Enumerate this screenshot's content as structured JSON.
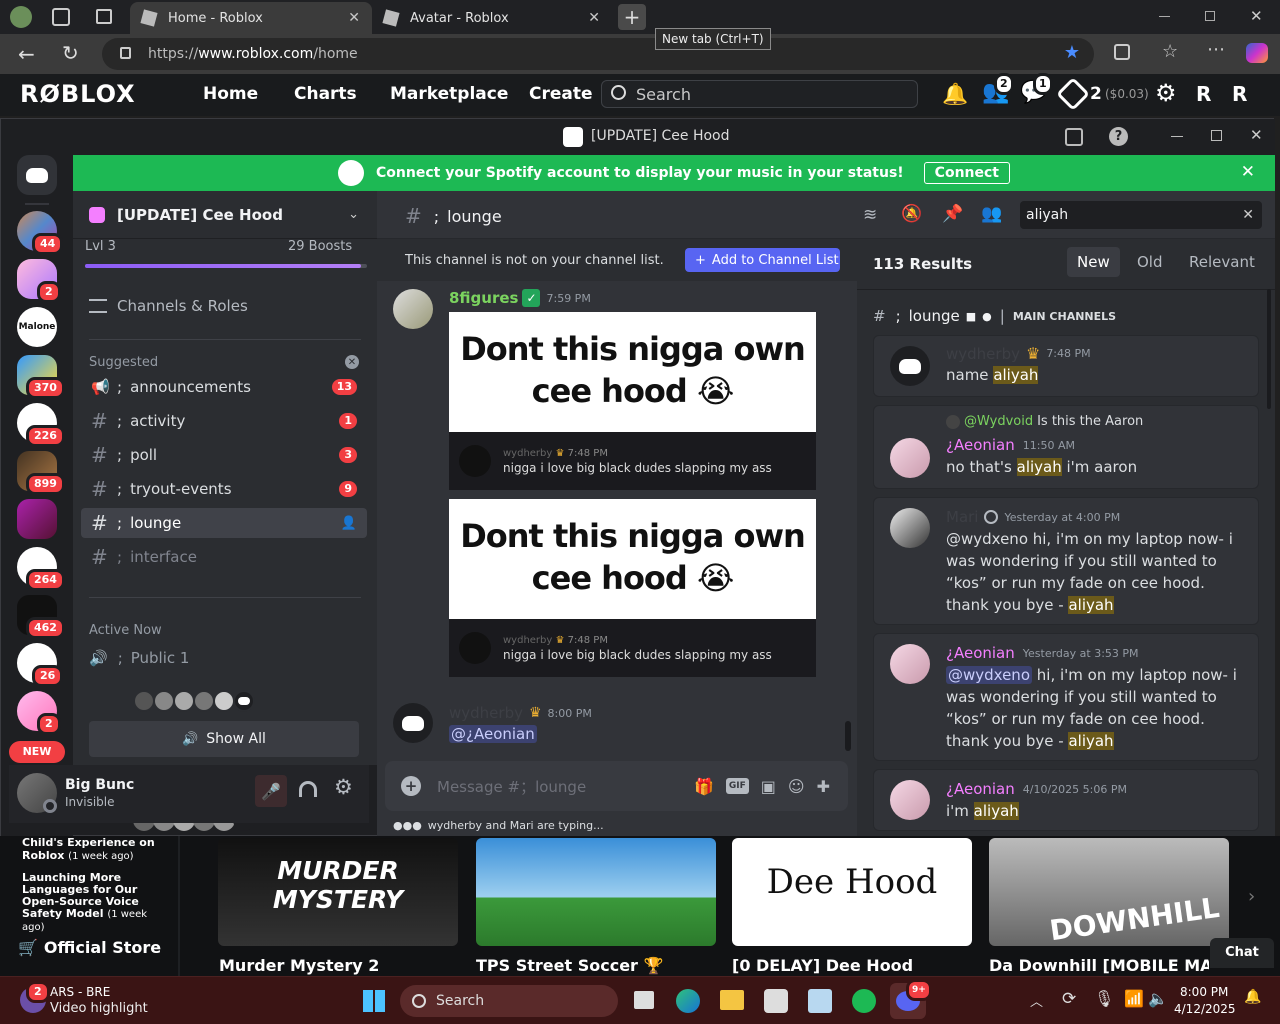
{
  "browser": {
    "tabs": [
      {
        "label": "Home - Roblox"
      },
      {
        "label": "Avatar - Roblox"
      }
    ],
    "new_tab_tooltip": "New tab (Ctrl+T)",
    "url_prefix": "https://",
    "url_host": "www.roblox.com",
    "url_path": "/home"
  },
  "roblox": {
    "logo": "RØBLOX",
    "nav": [
      "Home",
      "Charts",
      "Marketplace",
      "Create"
    ],
    "search_placeholder": "Search",
    "friends_badge": "2",
    "messages_badge": "1",
    "robux": "2",
    "robux_usd": "($0.03)",
    "news": [
      {
        "title": "Child's Experience on Roblox",
        "age": "(1 week ago)"
      },
      {
        "title": "Launching More Languages for Our Open-Source Voice Safety Model",
        "age": "(1 week ago)"
      }
    ],
    "official_store": "Official Store",
    "games": [
      {
        "title": "Murder Mystery 2",
        "thumb": "MURDER MYSTERY"
      },
      {
        "title": "TPS Street Soccer 🏆",
        "thumb": ""
      },
      {
        "title": "[0 DELAY] Dee Hood",
        "thumb": "Dee Hood"
      },
      {
        "title": "Da Downhill [MOBILE MACRO]",
        "thumb": "DOWNHILL"
      }
    ],
    "chat_label": "Chat"
  },
  "discord": {
    "window_title": "[UPDATE] Cee Hood",
    "spotify": {
      "text": "Connect your Spotify account to display your music in your status!",
      "button": "Connect"
    },
    "server_badges": [
      "44",
      "2",
      "",
      "370",
      "226",
      "899",
      "",
      "264",
      "462",
      "26",
      "2"
    ],
    "new_label": "NEW",
    "server": {
      "name": "[UPDATE] Cee Hood",
      "level": "Lvl 3",
      "boosts": "29 Boosts",
      "boost_progress": 0.98
    },
    "channels_roles": "Channels & Roles",
    "suggested_label": "Suggested",
    "channels": [
      {
        "name": "announcements",
        "count": "13",
        "icon": "megaphone-icon"
      },
      {
        "name": "activity",
        "count": "1",
        "icon": "hash-icon"
      },
      {
        "name": "poll",
        "count": "3",
        "icon": "hash-icon"
      },
      {
        "name": "tryout-events",
        "count": "9",
        "icon": "hash-icon"
      },
      {
        "name": "lounge",
        "count": "",
        "icon": "hash-icon"
      },
      {
        "name": "interface",
        "count": "",
        "icon": "hash-icon"
      }
    ],
    "channel_prefix": ";",
    "active_now": "Active Now",
    "voice_channel": "Public 1",
    "show_all": "Show All",
    "user": {
      "name": "Big Bunc",
      "status": "Invisible"
    },
    "chat": {
      "channel": "lounge",
      "not_on_list": "This channel is not on your channel list.",
      "add_button": "Add to Channel List",
      "messages": [
        {
          "author": "8figures",
          "time": "7:59 PM",
          "meme_line1": "Dont this nigga own",
          "meme_line2": "cee hood 😭",
          "quote_author": "wydherby",
          "quote_time": "7:48 PM",
          "quote_text": "nigga i love big black dudes slapping my ass"
        },
        {
          "meme_line1": "Dont this nigga own",
          "meme_line2": "cee hood 😭",
          "quote_author": "wydherby",
          "quote_time": "7:48 PM",
          "quote_text": "nigga i love big black dudes slapping my ass"
        },
        {
          "author": "wydherby",
          "time": "8:00 PM",
          "text": "@¿Aeonian"
        }
      ],
      "input_placeholder": "Message #；lounge",
      "typing": "wydherby and Mari are typing..."
    },
    "search": {
      "query": "aliyah",
      "results_count": "113 Results",
      "sort": [
        "New",
        "Old",
        "Relevant"
      ],
      "channel_header": "lounge",
      "channel_category": "MAIN CHANNELS",
      "results": [
        {
          "author": "wydherby",
          "time": "7:48 PM",
          "pre": "name ",
          "hl": "aliyah",
          "post": ""
        },
        {
          "reply_to": "@Wydvoid",
          "reply_text": "Is this the Aaron",
          "author": "¿Aeonian",
          "time": "11:50 AM",
          "pre": "no that's ",
          "hl": "aliyah",
          "post": " i'm aaron"
        },
        {
          "author": "Mari",
          "time": "Yesterday at 4:00 PM",
          "pre": "@wydxeno  hi, i'm on my laptop now- i was wondering if you still wanted to “kos” or run my fade on cee hood. thank you bye - ",
          "hl": "aliyah",
          "post": ""
        },
        {
          "author": "¿Aeonian",
          "time": "Yesterday at 3:53 PM",
          "mention": "@wydxeno",
          "pre": " hi, i'm on my laptop now- i was wondering if you still wanted to “kos” or run my fade on cee hood. thank you bye - ",
          "hl": "aliyah",
          "post": ""
        },
        {
          "author": "¿Aeonian",
          "time": "4/10/2025 5:06 PM",
          "pre": "i'm ",
          "hl": "aliyah",
          "post": ""
        }
      ]
    }
  },
  "taskbar": {
    "notif_badge": "2",
    "media_title": "ARS - BRE",
    "media_sub": "Video highlight",
    "search": "Search",
    "discord_badge": "9+",
    "time": "8:00 PM",
    "date": "4/12/2025"
  }
}
